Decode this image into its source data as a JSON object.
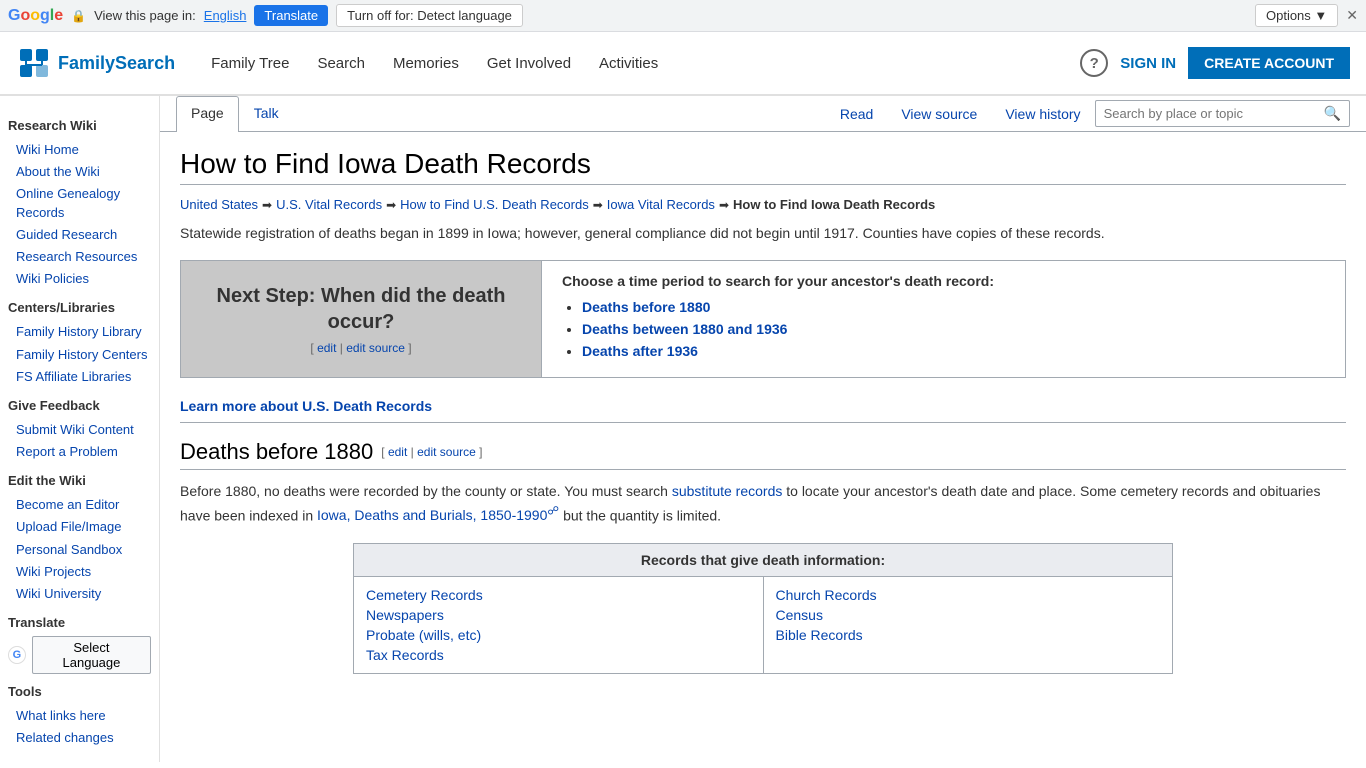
{
  "translate_bar": {
    "view_text": "View this page in:",
    "language": "English",
    "translate_btn": "Translate",
    "turn_off_btn": "Turn off for: Detect language",
    "options_btn": "Options ▼",
    "close_btn": "✕"
  },
  "header": {
    "logo_text": "FamilySearch",
    "nav": {
      "family_tree": "Family Tree",
      "search": "Search",
      "memories": "Memories",
      "get_involved": "Get Involved",
      "activities": "Activities"
    },
    "sign_in": "SIGN IN",
    "create_account": "CREATE ACCOUNT"
  },
  "sidebar": {
    "section1_title": "Research Wiki",
    "links1": [
      "Wiki Home",
      "About the Wiki",
      "Online Genealogy Records",
      "Guided Research",
      "Research Resources",
      "Wiki Policies"
    ],
    "section2_title": "Centers/Libraries",
    "links2": [
      "Family History Library",
      "Family History Centers",
      "FS Affiliate Libraries"
    ],
    "section3_title": "Give Feedback",
    "links3": [
      "Submit Wiki Content",
      "Report a Problem"
    ],
    "section4_title": "Edit the Wiki",
    "links4": [
      "Become an Editor",
      "Upload File/Image",
      "Personal Sandbox",
      "Wiki Projects",
      "Wiki University"
    ],
    "section5_title": "Translate",
    "section6_title": "Tools",
    "links6": [
      "What links here",
      "Related changes"
    ],
    "select_language": "Select Language"
  },
  "page_tabs": {
    "page": "Page",
    "talk": "Talk",
    "read": "Read",
    "view_source": "View source",
    "view_history": "View history",
    "search_placeholder": "Search by place or topic"
  },
  "article": {
    "title": "How to Find Iowa Death Records",
    "breadcrumb": [
      "United States",
      "U.S. Vital Records",
      "How to Find U.S. Death Records",
      "Iowa Vital Records",
      "How to Find Iowa Death Records"
    ],
    "intro": "Statewide registration of deaths began in 1899 in Iowa; however, general compliance did not begin until 1917. Counties have copies of these records.",
    "navbox": {
      "left_title": "Next Step: When did the death occur?",
      "left_edit": "[ edit | edit source ]",
      "right_title": "Choose a time period to search for your ancestor's death record:",
      "right_links": [
        "Deaths before 1880",
        "Deaths between 1880 and 1936",
        "Deaths after 1936"
      ]
    },
    "learn_more": "Learn more about U.S. Death Records",
    "section1": {
      "title": "Deaths before 1880",
      "edit_links": "[ edit | edit source ]",
      "text": "Before 1880, no deaths were recorded by the county or state. You must search substitute records to locate your ancestor's death date and place. Some cemetery records and obituaries have been indexed in Iowa, Deaths and Burials, 1850-1990",
      "text_end": " but the quantity is limited.",
      "substitute_link": "substitute records",
      "iowa_link": "Iowa, Deaths and Burials, 1850-1990",
      "external_icon": "☍"
    },
    "records_table": {
      "header": "Records that give death information:",
      "col1": [
        "Cemetery Records",
        "Newspapers",
        "Probate (wills, etc)",
        "Tax Records"
      ],
      "col2": [
        "Church Records",
        "Census",
        "Bible Records"
      ]
    }
  }
}
